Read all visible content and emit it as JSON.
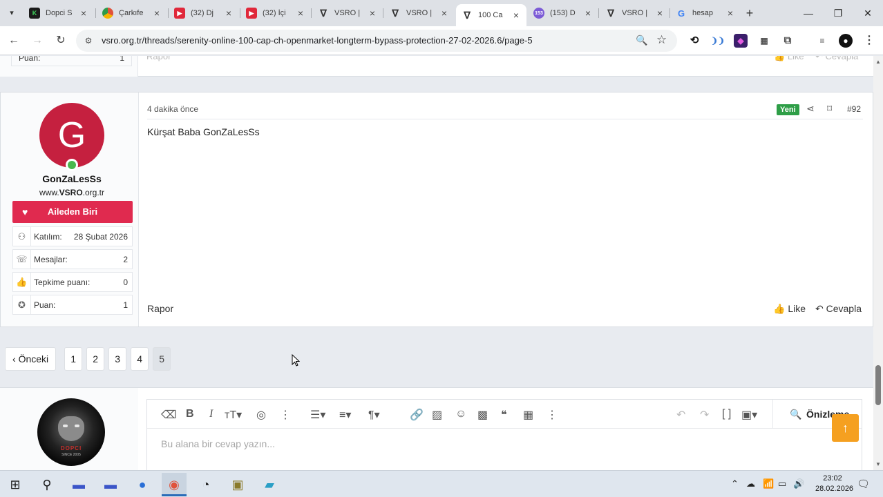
{
  "browser": {
    "tabs": [
      {
        "title": "Dopci S",
        "icon": "green-k-icon",
        "color": "#1b1b1b",
        "glyph": "K",
        "active": false
      },
      {
        "title": "Çarkıfe",
        "icon": "chrome-color-icon",
        "color": "#e0523b",
        "glyph": "",
        "active": false
      },
      {
        "title": "(32) Dj",
        "icon": "youtube-icon",
        "color": "#e0283a",
        "glyph": "▶",
        "active": false
      },
      {
        "title": "(32) İçi",
        "icon": "youtube-icon",
        "color": "#e0283a",
        "glyph": "▶",
        "active": false
      },
      {
        "title": "VSRO |",
        "icon": "vsro-icon",
        "color": "#333333",
        "glyph": "V",
        "active": false
      },
      {
        "title": "VSRO |",
        "icon": "vsro-icon",
        "color": "#333333",
        "glyph": "V",
        "active": false
      },
      {
        "title": "100 Ca",
        "icon": "vsro-icon",
        "color": "#333333",
        "glyph": "V",
        "active": true
      },
      {
        "title": "(153) D",
        "icon": "discord-icon",
        "color": "#7c5bd6",
        "glyph": "153",
        "active": false
      },
      {
        "title": "VSRO |",
        "icon": "vsro-icon",
        "color": "#333333",
        "glyph": "V",
        "active": false
      },
      {
        "title": "hesap",
        "icon": "google-icon",
        "color": "#4285f4",
        "glyph": "G",
        "active": false
      }
    ],
    "url": "vsro.org.tr/threads/serenity-online-100-cap-ch-openmarket-longterm-bypass-protection-27-02-2026.6/page-5"
  },
  "prev_post": {
    "stat_label": "Puan:",
    "stat_value": "1",
    "report": "Rapor",
    "like": "Like",
    "reply": "Cevapla"
  },
  "post": {
    "avatar_letter": "G",
    "username": "GonZaLesSs",
    "title_prefix": "www.",
    "title_bold": "VSRO",
    "title_suffix": ".org.tr",
    "badge": "Aileden Biri",
    "stats": [
      {
        "icon": "user-plus-icon",
        "label": "Katılım:",
        "value": "28 Şubat 2026"
      },
      {
        "icon": "messages-icon",
        "label": "Mesajlar:",
        "value": "2"
      },
      {
        "icon": "thumbs-up-icon",
        "label": "Tepkime puanı:",
        "value": "0"
      },
      {
        "icon": "trophy-icon",
        "label": "Puan:",
        "value": "1"
      }
    ],
    "date": "4 dakika önce",
    "new_badge": "Yeni",
    "number": "#92",
    "body": "Kürşat Baba GonZaLesSs",
    "report": "Rapor",
    "like": "Like",
    "reply": "Cevapla"
  },
  "pagination": {
    "prev": "Önceki",
    "pages": [
      "1",
      "2",
      "3",
      "4",
      "5"
    ],
    "current": "5"
  },
  "reply_editor": {
    "avatar_label": "DOPCI",
    "avatar_sublabel": "SINCE 2005",
    "placeholder": "Bu alana bir cevap yazın...",
    "preview": "Önizleme"
  },
  "taskbar": {
    "time": "23:02",
    "date": "28.02.2026"
  },
  "colors": {
    "accent_red": "#e02a4f",
    "avatar_red": "#c5203f",
    "new_green": "#2e9e47",
    "scroll_top_orange": "#f5a020"
  }
}
